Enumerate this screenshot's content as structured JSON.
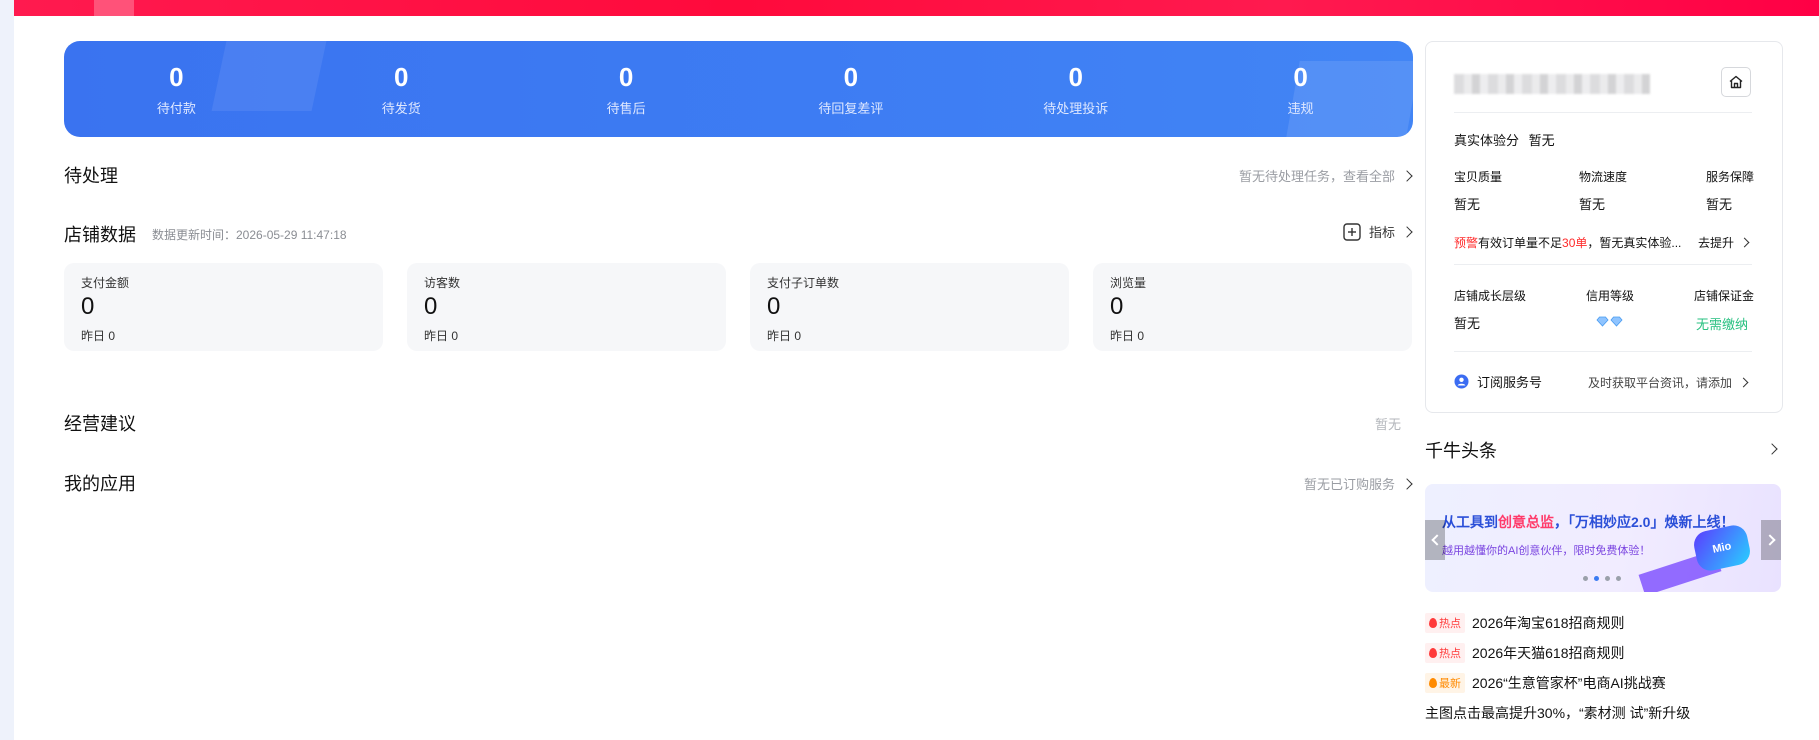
{
  "stats": [
    {
      "value": "0",
      "label": "待付款"
    },
    {
      "value": "0",
      "label": "待发货"
    },
    {
      "value": "0",
      "label": "待售后"
    },
    {
      "value": "0",
      "label": "待回复差评"
    },
    {
      "value": "0",
      "label": "待处理投诉"
    },
    {
      "value": "0",
      "label": "违规"
    }
  ],
  "pending": {
    "title": "待处理",
    "link": "暂无待处理任务，查看全部"
  },
  "shop_data": {
    "title": "店铺数据",
    "update_time": "数据更新时间：2026-05-29 11:47:18",
    "indicator_label": "指标",
    "metrics": [
      {
        "label": "支付金额",
        "value": "0",
        "yesterday": "昨日 0"
      },
      {
        "label": "访客数",
        "value": "0",
        "yesterday": "昨日 0"
      },
      {
        "label": "支付子订单数",
        "value": "0",
        "yesterday": "昨日 0"
      },
      {
        "label": "浏览量",
        "value": "0",
        "yesterday": "昨日 0"
      }
    ]
  },
  "advice": {
    "title": "经营建议",
    "status": "暂无"
  },
  "apps": {
    "title": "我的应用",
    "link": "暂无已订购服务"
  },
  "shop_card": {
    "experience_label": "真实体验分",
    "experience_value": "暂无",
    "scores": [
      {
        "label": "宝贝质量",
        "value": "暂无"
      },
      {
        "label": "物流速度",
        "value": "暂无"
      },
      {
        "label": "服务保障",
        "value": "暂无"
      }
    ],
    "warning_tag": "预警",
    "warning_text_a": "有效订单量不足",
    "warning_highlight": "30单",
    "warning_text_b": "，暂无真实体验...",
    "improve_label": "去提升",
    "levels": [
      {
        "label": "店铺成长层级",
        "value": "暂无"
      },
      {
        "label": "信用等级",
        "value": ""
      },
      {
        "label": "店铺保证金",
        "value": "无需缴纳"
      }
    ],
    "subscribe_label": "订阅服务号",
    "subscribe_hint": "及时获取平台资讯，请添加",
    "colors": {
      "warning": "#ff2b2b",
      "deposit": "#27c080",
      "accent": "#3b7cf2"
    }
  },
  "news": {
    "title": "千牛头条",
    "banner": {
      "headline_a": "从工具到",
      "headline_b": "创意总监",
      "headline_c": "，「万相妙应2.0」焕新上线！",
      "sub": "越用越懂你的AI创意伙伴，限时免费体验！",
      "badge": "Mio"
    },
    "items": [
      {
        "tag": "热点",
        "type": "hot",
        "text": "2026年淘宝618招商规则"
      },
      {
        "tag": "热点",
        "type": "hot",
        "text": "2026年天猫618招商规则"
      },
      {
        "tag": "最新",
        "type": "new",
        "text": "2026“生意管家杯”电商AI挑战赛"
      }
    ],
    "plain_item": "主图点击最高提升30%，“素材测 试”新升级"
  }
}
